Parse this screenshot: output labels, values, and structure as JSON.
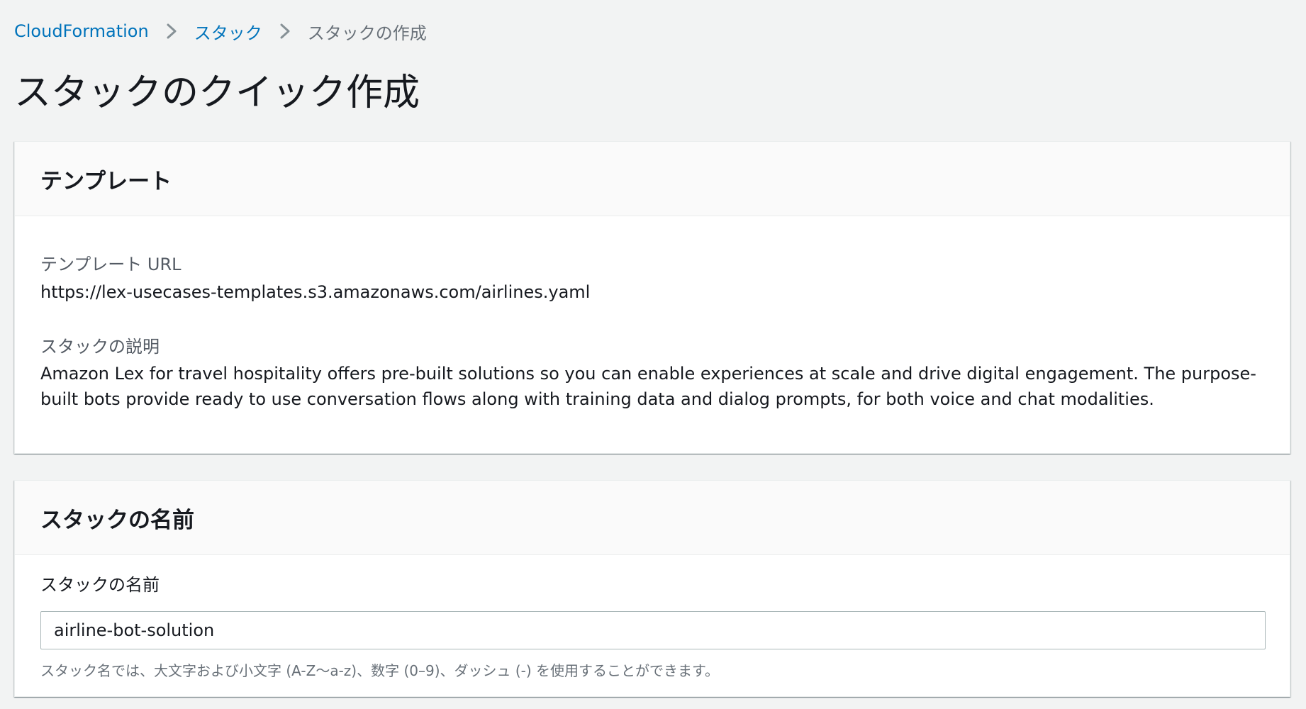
{
  "breadcrumb": {
    "items": [
      {
        "label": "CloudFormation"
      },
      {
        "label": "スタック"
      },
      {
        "label": "スタックの作成"
      }
    ]
  },
  "page": {
    "title": "スタックのクイック作成"
  },
  "template_panel": {
    "heading": "テンプレート",
    "url_label": "テンプレート URL",
    "url_value": "https://lex-usecases-templates.s3.amazonaws.com/airlines.yaml",
    "description_label": "スタックの説明",
    "description_value": "Amazon Lex for travel hospitality offers pre-built solutions so you can enable experiences at scale and drive digital engagement. The purpose-built bots provide ready to use conversation flows along with training data and dialog prompts, for both voice and chat modalities."
  },
  "stack_name_panel": {
    "heading": "スタックの名前",
    "field_label": "スタックの名前",
    "field_value": "airline-bot-solution",
    "constraint_text": "スタック名では、大文字および小文字 (A-Z〜a-z)、数字 (0–9)、ダッシュ (-) を使用することができます。"
  },
  "icons": {
    "breadcrumb_separator": "chevron-right-icon"
  },
  "colors": {
    "link": "#0073bb",
    "page_background": "#f2f3f3",
    "muted_text": "#687078"
  }
}
